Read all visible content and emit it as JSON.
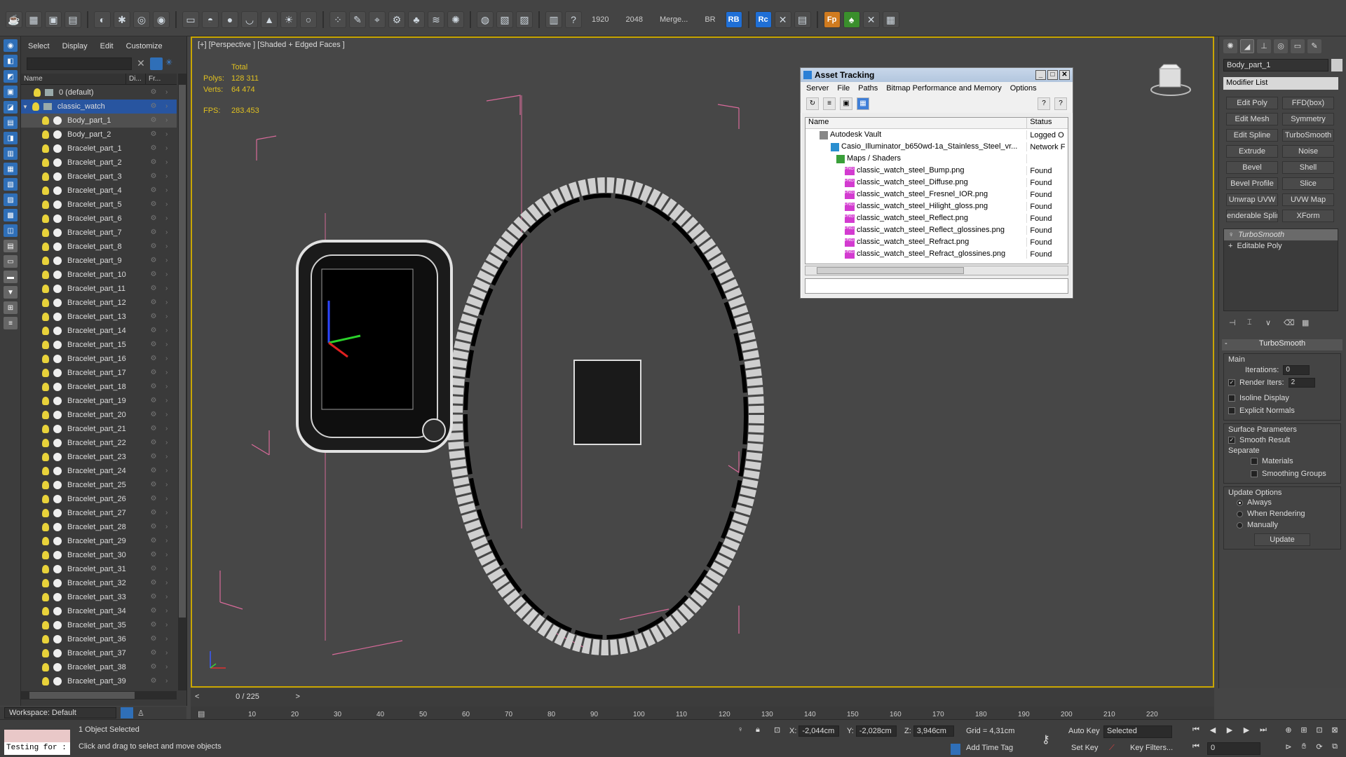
{
  "toolbar": {
    "res_w": "1920",
    "res_h": "2048",
    "merge": "Merge...",
    "br": "BR",
    "rb": "RB",
    "rc": "Rc",
    "fp": "Fp"
  },
  "scene": {
    "menu": [
      "Select",
      "Display",
      "Edit",
      "Customize"
    ],
    "col_name": "Name",
    "col_di": "Di...",
    "col_fr": "Fr...",
    "items": [
      {
        "label": "0 (default)",
        "type": "layer",
        "state": "normal"
      },
      {
        "label": "classic_watch",
        "type": "layer",
        "state": "selected"
      },
      {
        "label": "Body_part_1",
        "type": "object",
        "state": "highlight"
      },
      {
        "label": "Body_part_2",
        "type": "object",
        "state": "normal"
      },
      {
        "label": "Bracelet_part_1",
        "type": "object",
        "state": "normal"
      },
      {
        "label": "Bracelet_part_2",
        "type": "object",
        "state": "normal"
      },
      {
        "label": "Bracelet_part_3",
        "type": "object",
        "state": "normal"
      },
      {
        "label": "Bracelet_part_4",
        "type": "object",
        "state": "normal"
      },
      {
        "label": "Bracelet_part_5",
        "type": "object",
        "state": "normal"
      },
      {
        "label": "Bracelet_part_6",
        "type": "object",
        "state": "normal"
      },
      {
        "label": "Bracelet_part_7",
        "type": "object",
        "state": "normal"
      },
      {
        "label": "Bracelet_part_8",
        "type": "object",
        "state": "normal"
      },
      {
        "label": "Bracelet_part_9",
        "type": "object",
        "state": "normal"
      },
      {
        "label": "Bracelet_part_10",
        "type": "object",
        "state": "normal"
      },
      {
        "label": "Bracelet_part_11",
        "type": "object",
        "state": "normal"
      },
      {
        "label": "Bracelet_part_12",
        "type": "object",
        "state": "normal"
      },
      {
        "label": "Bracelet_part_13",
        "type": "object",
        "state": "normal"
      },
      {
        "label": "Bracelet_part_14",
        "type": "object",
        "state": "normal"
      },
      {
        "label": "Bracelet_part_15",
        "type": "object",
        "state": "normal"
      },
      {
        "label": "Bracelet_part_16",
        "type": "object",
        "state": "normal"
      },
      {
        "label": "Bracelet_part_17",
        "type": "object",
        "state": "normal"
      },
      {
        "label": "Bracelet_part_18",
        "type": "object",
        "state": "normal"
      },
      {
        "label": "Bracelet_part_19",
        "type": "object",
        "state": "normal"
      },
      {
        "label": "Bracelet_part_20",
        "type": "object",
        "state": "normal"
      },
      {
        "label": "Bracelet_part_21",
        "type": "object",
        "state": "normal"
      },
      {
        "label": "Bracelet_part_22",
        "type": "object",
        "state": "normal"
      },
      {
        "label": "Bracelet_part_23",
        "type": "object",
        "state": "normal"
      },
      {
        "label": "Bracelet_part_24",
        "type": "object",
        "state": "normal"
      },
      {
        "label": "Bracelet_part_25",
        "type": "object",
        "state": "normal"
      },
      {
        "label": "Bracelet_part_26",
        "type": "object",
        "state": "normal"
      },
      {
        "label": "Bracelet_part_27",
        "type": "object",
        "state": "normal"
      },
      {
        "label": "Bracelet_part_28",
        "type": "object",
        "state": "normal"
      },
      {
        "label": "Bracelet_part_29",
        "type": "object",
        "state": "normal"
      },
      {
        "label": "Bracelet_part_30",
        "type": "object",
        "state": "normal"
      },
      {
        "label": "Bracelet_part_31",
        "type": "object",
        "state": "normal"
      },
      {
        "label": "Bracelet_part_32",
        "type": "object",
        "state": "normal"
      },
      {
        "label": "Bracelet_part_33",
        "type": "object",
        "state": "normal"
      },
      {
        "label": "Bracelet_part_34",
        "type": "object",
        "state": "normal"
      },
      {
        "label": "Bracelet_part_35",
        "type": "object",
        "state": "normal"
      },
      {
        "label": "Bracelet_part_36",
        "type": "object",
        "state": "normal"
      },
      {
        "label": "Bracelet_part_37",
        "type": "object",
        "state": "normal"
      },
      {
        "label": "Bracelet_part_38",
        "type": "object",
        "state": "normal"
      },
      {
        "label": "Bracelet_part_39",
        "type": "object",
        "state": "normal"
      }
    ]
  },
  "viewport": {
    "label": "[+] [Perspective ] [Shaded + Edged Faces ]",
    "total": "Total",
    "polys_label": "Polys:",
    "polys": "128 311",
    "verts_label": "Verts:",
    "verts": "64 474",
    "fps_label": "FPS:",
    "fps": "283.453"
  },
  "asset_tracking": {
    "title": "Asset Tracking",
    "menu": [
      "Server",
      "File",
      "Paths",
      "Bitmap Performance and Memory",
      "Options"
    ],
    "col_name": "Name",
    "col_status": "Status",
    "rows": [
      {
        "name": "Autodesk Vault",
        "status": "Logged O"
      },
      {
        "name": "Casio_Illuminator_b650wd-1a_Stainless_Steel_vr...",
        "status": "Network F"
      },
      {
        "name": "Maps / Shaders",
        "status": ""
      },
      {
        "name": "classic_watch_steel_Bump.png",
        "status": "Found"
      },
      {
        "name": "classic_watch_steel_Diffuse.png",
        "status": "Found"
      },
      {
        "name": "classic_watch_steel_Fresnel_IOR.png",
        "status": "Found"
      },
      {
        "name": "classic_watch_steel_Hilight_gloss.png",
        "status": "Found"
      },
      {
        "name": "classic_watch_steel_Reflect.png",
        "status": "Found"
      },
      {
        "name": "classic_watch_steel_Reflect_glossines.png",
        "status": "Found"
      },
      {
        "name": "classic_watch_steel_Refract.png",
        "status": "Found"
      },
      {
        "name": "classic_watch_steel_Refract_glossines.png",
        "status": "Found"
      }
    ]
  },
  "command_panel": {
    "object_name": "Body_part_1",
    "modifier_list": "Modifier List",
    "modifiers": [
      "Edit Poly",
      "FFD(box)",
      "Edit Mesh",
      "Symmetry",
      "Edit Spline",
      "TurboSmooth",
      "Extrude",
      "Noise",
      "Bevel",
      "Shell",
      "Bevel Profile",
      "Slice",
      "Unwrap UVW",
      "UVW Map",
      "enderable Splir",
      "XForm"
    ],
    "stack": [
      "TurboSmooth",
      "Editable Poly"
    ],
    "rollout_title": "TurboSmooth",
    "main": "Main",
    "iterations_label": "Iterations:",
    "iterations": "0",
    "render_iters_label": "Render Iters:",
    "render_iters": "2",
    "isoline": "Isoline Display",
    "explicit_normals": "Explicit Normals",
    "surface_params": "Surface Parameters",
    "smooth_result": "Smooth Result",
    "separate": "Separate",
    "materials": "Materials",
    "smoothing_groups": "Smoothing Groups",
    "update_options": "Update Options",
    "always": "Always",
    "when_rendering": "When Rendering",
    "manually": "Manually",
    "update": "Update"
  },
  "timeline": {
    "frame": "0 / 225",
    "ticks": [
      "10",
      "20",
      "30",
      "40",
      "50",
      "60",
      "70",
      "80",
      "90",
      "100",
      "110",
      "120",
      "130",
      "140",
      "150",
      "160",
      "170",
      "180",
      "190",
      "200",
      "210",
      "220"
    ]
  },
  "workspace": "Workspace: Default",
  "status": {
    "testing": "Testing for :",
    "selected": "1 Object Selected",
    "hint": "Click and drag to select and move objects",
    "x_label": "X:",
    "x": "-2,044cm",
    "y_label": "Y:",
    "y": "-2,028cm",
    "z_label": "Z:",
    "z": "3,946cm",
    "grid": "Grid = 4,31cm",
    "add_time_tag": "Add Time Tag",
    "auto_key": "Auto Key",
    "set_key": "Set Key",
    "selected_dd": "Selected",
    "key_filters": "Key Filters...",
    "frame_field": "0"
  }
}
